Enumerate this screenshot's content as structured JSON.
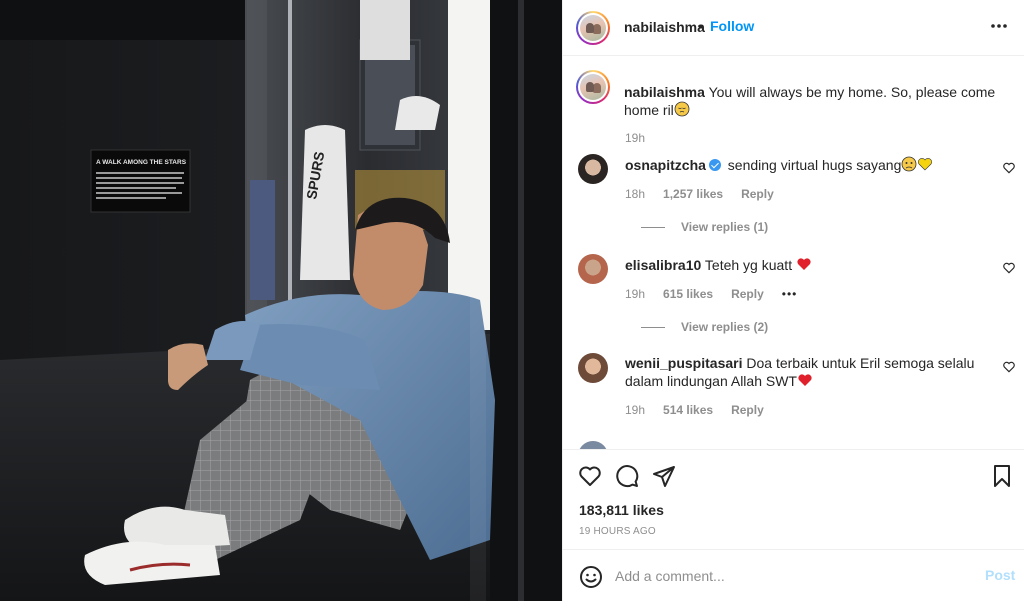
{
  "post": {
    "author": "nabilaishma",
    "separator": "•",
    "follow_label": "Follow",
    "photo_sign_title": "A WALK AMONG THE STARS",
    "caption": {
      "username": "nabilaishma",
      "text": "You will always be my home. So, please come home ril",
      "time": "19h"
    }
  },
  "comments": [
    {
      "username": "osnapitzcha",
      "verified": true,
      "text": "sending virtual hugs sayang",
      "time": "18h",
      "likes": "1,257 likes",
      "reply_label": "Reply",
      "view_replies": "View replies (1)",
      "avatar_color": "#3a3530"
    },
    {
      "username": "elisalibra10",
      "verified": false,
      "text": "Teteh yg kuatt",
      "time": "19h",
      "likes": "615 likes",
      "reply_label": "Reply",
      "more": "•••",
      "view_replies": "View replies (2)",
      "avatar_color": "#c9a48a"
    },
    {
      "username": "wenii_puspitasari",
      "verified": false,
      "text": "Doa terbaik untuk Eril semoga selalu dalam lindungan Allah SWT",
      "time": "19h",
      "likes": "514 likes",
      "reply_label": "Reply",
      "avatar_color": "#8b6a55"
    }
  ],
  "footer": {
    "likes": "183,811 likes",
    "posted": "19 HOURS AGO",
    "comment_placeholder": "Add a comment...",
    "post_label": "Post"
  },
  "colors": {
    "accent": "#0095f6",
    "post_disabled": "#b2dffc",
    "heart_red": "#ed4956",
    "text": "#262626",
    "muted": "#8e8e8e"
  }
}
